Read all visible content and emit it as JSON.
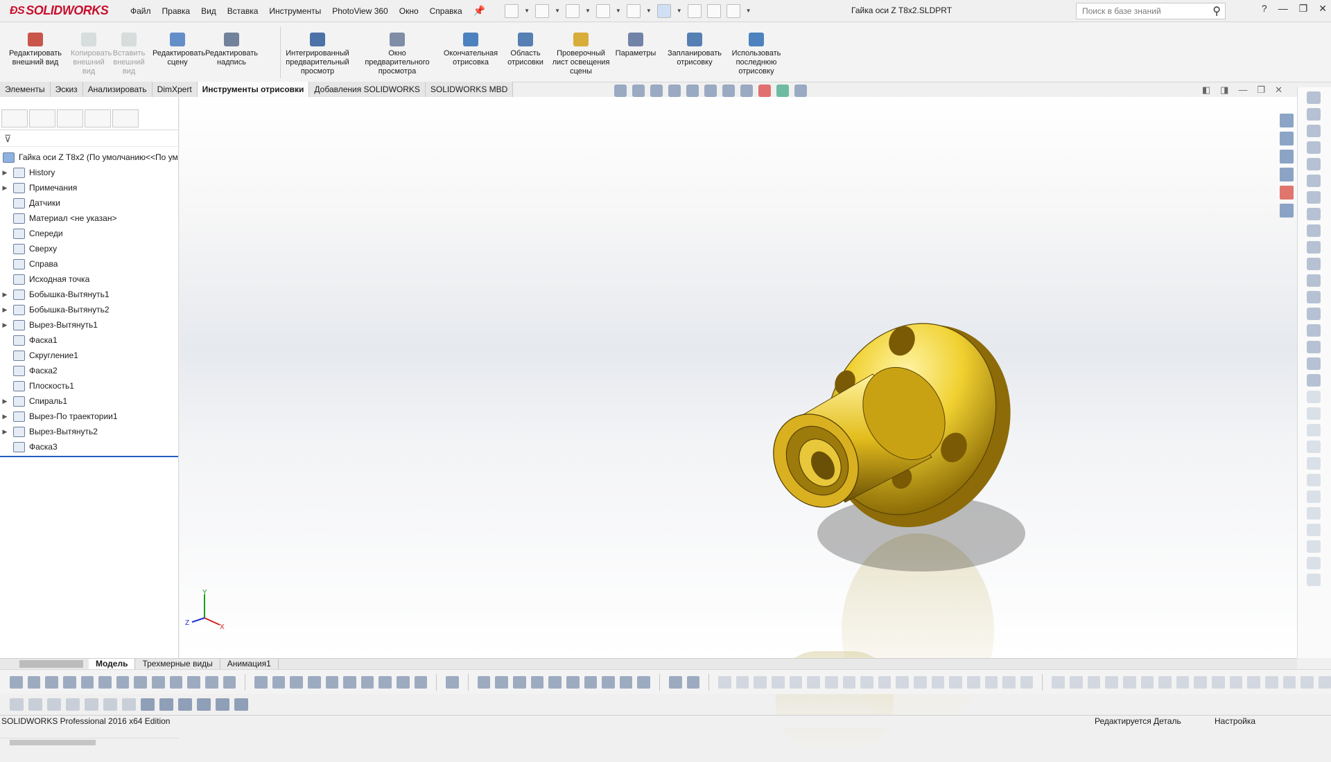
{
  "app": {
    "logo": "SOLIDWORKS",
    "title": "Гайка оси Z T8x2.SLDPRT"
  },
  "menu": [
    "Файл",
    "Правка",
    "Вид",
    "Вставка",
    "Инструменты",
    "PhotoView 360",
    "Окно",
    "Справка"
  ],
  "search": {
    "placeholder": "Поиск в базе знаний"
  },
  "ribbon": [
    {
      "label": "Редактировать внешний вид",
      "enabled": true
    },
    {
      "label": "Копировать внешний вид",
      "enabled": false
    },
    {
      "label": "Вставить внешний вид",
      "enabled": false
    },
    {
      "label": "Редактировать сцену",
      "enabled": true
    },
    {
      "label": "Редактировать надпись",
      "enabled": true
    },
    {
      "label": "Интегрированный предварительный просмотр",
      "enabled": true
    },
    {
      "label": "Окно предварительного просмотра",
      "enabled": true
    },
    {
      "label": "Окончательная отрисовка",
      "enabled": true
    },
    {
      "label": "Область отрисовки",
      "enabled": true
    },
    {
      "label": "Проверочный лист освещения сцены",
      "enabled": true
    },
    {
      "label": "Параметры",
      "enabled": true
    },
    {
      "label": "Запланировать отрисовку",
      "enabled": true
    },
    {
      "label": "Использовать последнюю отрисовку",
      "enabled": true
    }
  ],
  "tabs": [
    "Элементы",
    "Эскиз",
    "Анализировать",
    "DimXpert",
    "Инструменты отрисовки",
    "Добавления SOLIDWORKS",
    "SOLIDWORKS MBD"
  ],
  "active_tab": "Инструменты отрисовки",
  "tree": {
    "root": "Гайка оси Z T8x2  (По умолчанию<<По ум",
    "items": [
      {
        "label": "History",
        "expandable": true
      },
      {
        "label": "Примечания",
        "expandable": true
      },
      {
        "label": "Датчики",
        "expandable": false
      },
      {
        "label": "Материал <не указан>",
        "expandable": false
      },
      {
        "label": "Спереди",
        "expandable": false
      },
      {
        "label": "Сверху",
        "expandable": false
      },
      {
        "label": "Справа",
        "expandable": false
      },
      {
        "label": "Исходная точка",
        "expandable": false
      },
      {
        "label": "Бобышка-Вытянуть1",
        "expandable": true
      },
      {
        "label": "Бобышка-Вытянуть2",
        "expandable": true
      },
      {
        "label": "Вырез-Вытянуть1",
        "expandable": true
      },
      {
        "label": "Фаска1",
        "expandable": false
      },
      {
        "label": "Скругление1",
        "expandable": false
      },
      {
        "label": "Фаска2",
        "expandable": false
      },
      {
        "label": "Плоскость1",
        "expandable": false
      },
      {
        "label": "Спираль1",
        "expandable": true
      },
      {
        "label": "Вырез-По траектории1",
        "expandable": true
      },
      {
        "label": "Вырез-Вытянуть2",
        "expandable": true
      },
      {
        "label": "Фаска3",
        "expandable": false
      }
    ]
  },
  "bottom_tabs": [
    "Модель",
    "Трехмерные виды",
    "Анимация1"
  ],
  "status": {
    "left": "SOLIDWORKS Professional 2016 x64 Edition",
    "middle": "Редактируется Деталь",
    "right": "Настройка"
  },
  "colors": {
    "accent": "#c8102e",
    "part_gold": "#e6c21f"
  },
  "triad": {
    "x": "X",
    "y": "Y",
    "z": "Z"
  }
}
